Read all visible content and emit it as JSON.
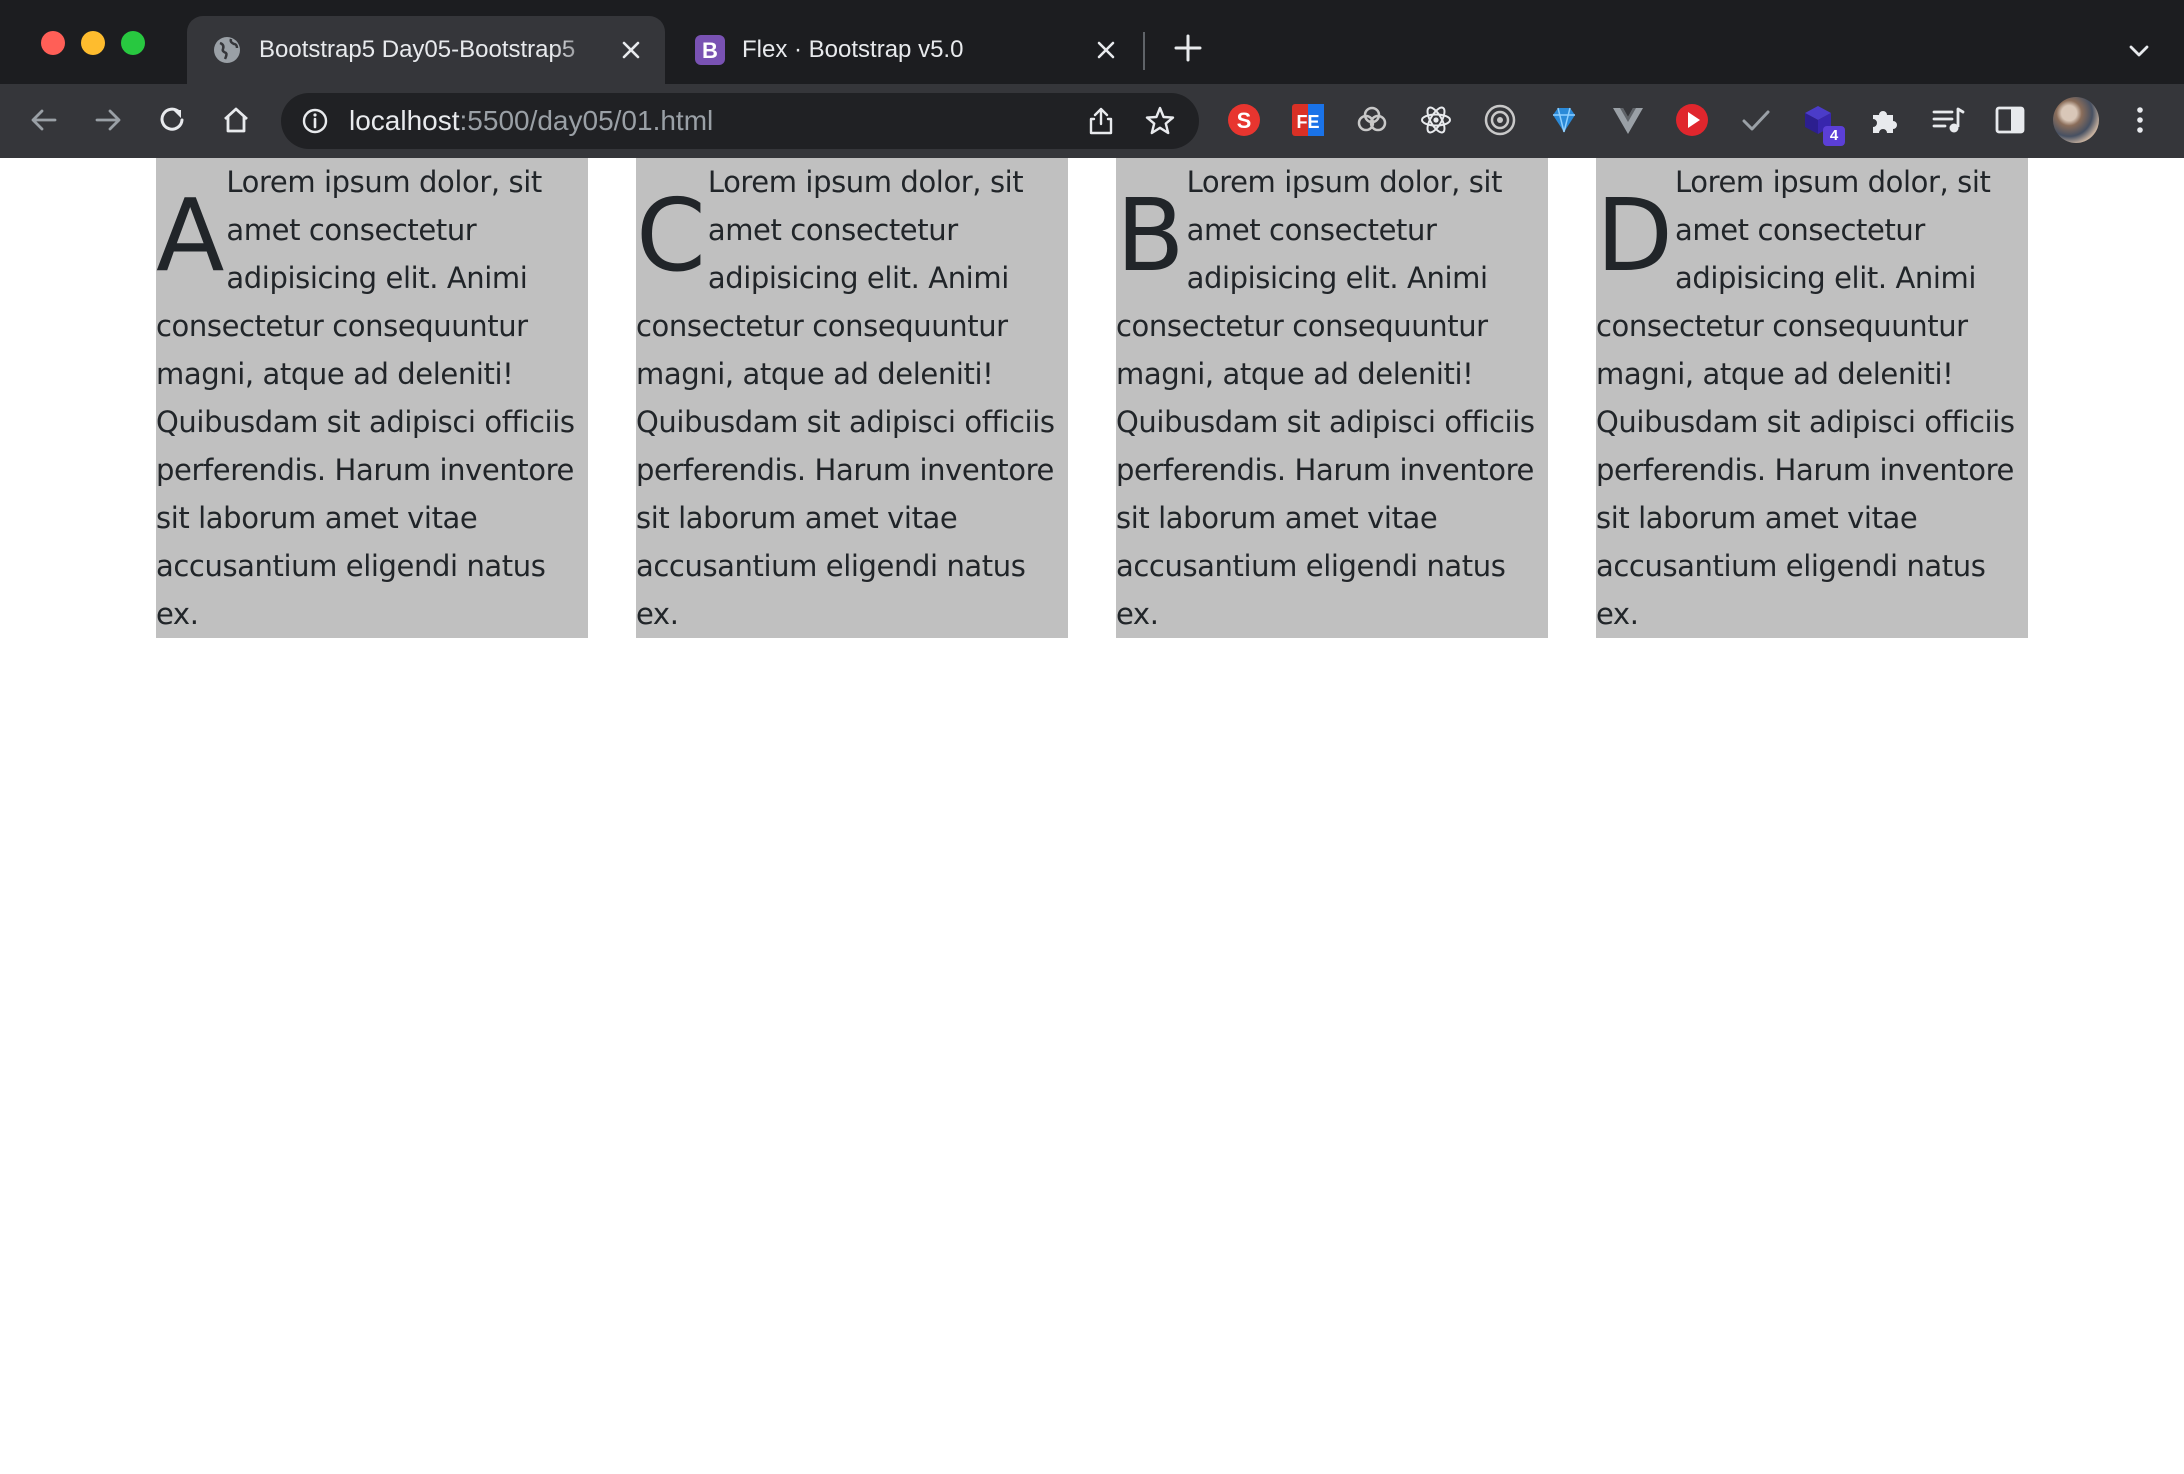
{
  "browser": {
    "tabs": [
      {
        "title": "Bootstrap5 Day05-Bootstrap5",
        "active": true,
        "favicon": "globe-icon"
      },
      {
        "title": "Flex · Bootstrap v5.0",
        "active": false,
        "favicon": "bootstrap-icon",
        "favicon_letter": "B"
      }
    ],
    "address": {
      "host": "localhost",
      "rest": ":5500/day05/01.html"
    },
    "extensions": [
      "s-extension-icon",
      "fe-extension-icon",
      "paw-extension-icon",
      "react-devtools-icon",
      "target-extension-icon",
      "diamond-extension-icon",
      "vue-devtools-icon",
      "play-extension-icon",
      "check-extension-icon",
      "cube-extension-icon",
      "puzzle-extensions-icon",
      "media-control-icon",
      "side-panel-icon"
    ],
    "extension_badge": "4",
    "colors": {
      "titlebar": "#1c1d20",
      "toolbar": "#35363a",
      "omnibox": "#202124",
      "bootstrap_purple": "#7952b3"
    }
  },
  "cards": [
    {
      "dropcap": "A",
      "text": "Lorem ipsum dolor, sit amet consectetur adipisicing elit. Animi consectetur consequuntur magni, atque ad deleniti! Quibusdam sit adipisci officiis perferendis. Harum inventore sit laborum amet vitae accusantium eligendi natus ex."
    },
    {
      "dropcap": "C",
      "text": "Lorem ipsum dolor, sit amet consectetur adipisicing elit. Animi consectetur consequuntur magni, atque ad deleniti! Quibusdam sit adipisci officiis perferendis. Harum inventore sit laborum amet vitae accusantium eligendi natus ex."
    },
    {
      "dropcap": "B",
      "text": "Lorem ipsum dolor, sit amet consectetur adipisicing elit. Animi consectetur consequuntur magni, atque ad deleniti! Quibusdam sit adipisci officiis perferendis. Harum inventore sit laborum amet vitae accusantium eligendi natus ex."
    },
    {
      "dropcap": "D",
      "text": "Lorem ipsum dolor, sit amet consectetur adipisicing elit. Animi consectetur consequuntur magni, atque ad deleniti! Quibusdam sit adipisci officiis perferendis. Harum inventore sit laborum amet vitae accusantium eligendi natus ex."
    }
  ],
  "page": {
    "card_background": "#c0c0c0",
    "text_color": "#212529"
  }
}
